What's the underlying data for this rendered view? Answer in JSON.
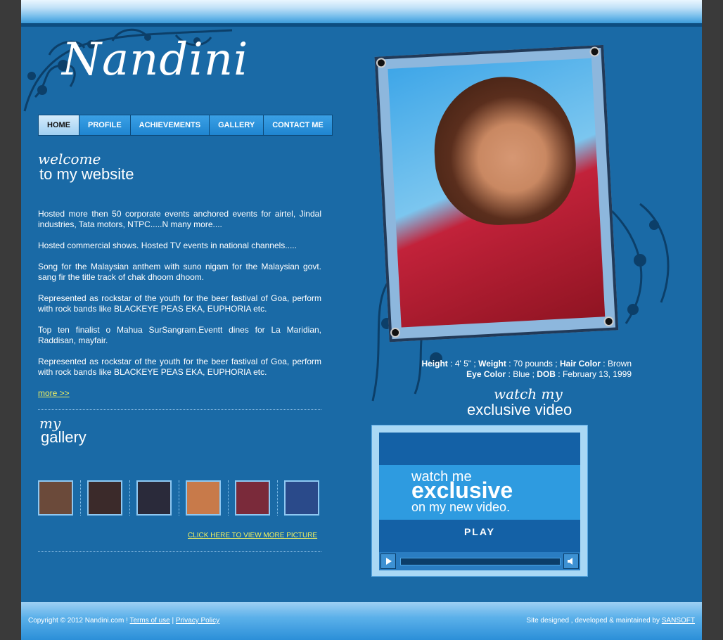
{
  "brand": {
    "logo_text": "Nandini"
  },
  "nav": {
    "items": [
      {
        "label": "HOME",
        "active": true
      },
      {
        "label": "PROFILE",
        "active": false
      },
      {
        "label": "ACHIEVEMENTS",
        "active": false
      },
      {
        "label": "GALLERY",
        "active": false
      },
      {
        "label": "CONTACT ME",
        "active": false
      }
    ]
  },
  "welcome": {
    "script": "welcome",
    "title": "to my website",
    "paragraphs": [
      "Hosted more then 50 corporate events anchored events for airtel, Jindal industries, Tata motors, NTPC.....N many more....",
      "Hosted commercial shows. Hosted TV events in national channels.....",
      "Song for the Malaysian anthem with suno nigam for the Malaysian govt. sang fir the title track of chak dhoom dhoom.",
      "Represented as rockstar of the youth for the beer fastival of Goa, perform with rock bands like BLACKEYE PEAS EKA, EUPHORIA etc.",
      "Top ten finalist o Mahua SurSangram.Eventt dines for La Maridian, Raddisan, mayfair.",
      "Represented as rockstar of the youth for the beer fastival of Goa, perform with rock bands like BLACKEYE PEAS EKA, EUPHORIA etc."
    ],
    "more_link": "more >>"
  },
  "gallery": {
    "script": "my",
    "title": "gallery",
    "view_more_link": "CLICK HERE TO VIEW MORE PICTURE",
    "thumb_colors": [
      "#6b4a3a",
      "#3b2a2a",
      "#2a2a3a",
      "#c87a4a",
      "#7a2a3a",
      "#2a4a8a"
    ]
  },
  "stats": {
    "height_label": "Height",
    "height_value": "4' 5\"",
    "weight_label": "Weight",
    "weight_value": "70 pounds",
    "hair_label": "Hair Color",
    "hair_value": "Brown",
    "eye_label": "Eye Color",
    "eye_value": "Blue",
    "dob_label": "DOB",
    "dob_value": "February 13, 1999"
  },
  "video": {
    "script": "watch my",
    "title": "exclusive video",
    "line1": "watch me",
    "line2": "exclusive",
    "line3": "on my new video.",
    "play_label": "PLAY"
  },
  "footer": {
    "copyright": "Copyright © 2012 Nandini.com !",
    "terms": "Terms of use",
    "separator": "|",
    "privacy": "Privacy Policy",
    "credit": "Site designed , developed & maintained by",
    "credit_link": "SANSOFT"
  },
  "colors": {
    "page_bg": "#1a6aa6",
    "outer_bg": "#3a3a3a",
    "link_yellow": "#f0f060"
  }
}
